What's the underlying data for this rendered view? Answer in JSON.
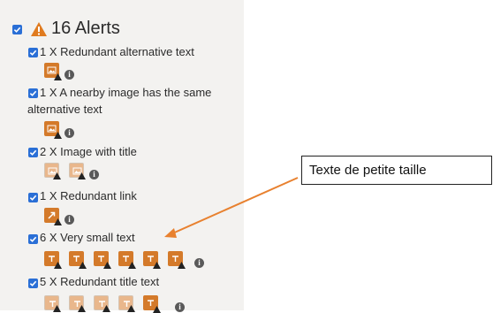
{
  "alerts": {
    "title": "16 Alerts"
  },
  "items": [
    {
      "label": "1 X Redundant alternative text"
    },
    {
      "label_line1": "1 X A nearby image has the same",
      "label_line2": "alternative text"
    },
    {
      "label": "2 X Image with title"
    },
    {
      "label": "1 X Redundant link"
    },
    {
      "label": "6 X Very small text"
    },
    {
      "label": "5 X Redundant title text"
    }
  ],
  "info_glyph": "i",
  "callout": {
    "text": "Texte de petite taille"
  },
  "colors": {
    "accent": "#2a6fd6",
    "alert_orange": "#d47a2a",
    "panel_bg": "#f3f2f0",
    "arrow": "#e8812f"
  }
}
